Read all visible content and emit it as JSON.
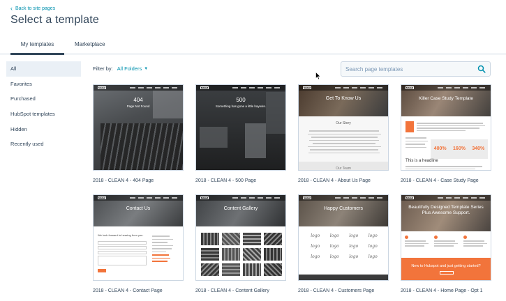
{
  "header": {
    "back_label": "Back to site pages",
    "title": "Select a template"
  },
  "tabs": [
    {
      "label": "My templates",
      "active": true
    },
    {
      "label": "Marketplace",
      "active": false
    }
  ],
  "sidebar": {
    "items": [
      {
        "label": "All",
        "active": true
      },
      {
        "label": "Favorites"
      },
      {
        "label": "Purchased"
      },
      {
        "label": "HubSpot templates"
      },
      {
        "label": "Hidden"
      },
      {
        "label": "Recently used"
      }
    ]
  },
  "filter": {
    "label": "Filter by:",
    "value": "All Folders"
  },
  "search": {
    "placeholder": "Search page templates"
  },
  "templates": [
    {
      "label": "2018 - CLEAN 4 - 404 Page",
      "hero_title": "404",
      "hero_sub": "Page Not Found"
    },
    {
      "label": "2018 - CLEAN 4 - 500 Page",
      "hero_title": "500",
      "hero_sub": "Something has gone a little haywire."
    },
    {
      "label": "2018 - CLEAN 4 - About Us Page",
      "hero_title": "Get To Know Us",
      "section": "Our Story",
      "footer": "Our Team"
    },
    {
      "label": "2018 - CLEAN 4 - Case Study Page",
      "hero_title": "Killer Case Study Template",
      "stats": [
        "400%",
        "160%",
        "340%"
      ],
      "headline": "This is a headline"
    },
    {
      "label": "2018 - CLEAN 4 - Contact Page",
      "hero_title": "Contact Us",
      "body": "We look forward to hearing from you."
    },
    {
      "label": "2018 - CLEAN 4 - Content Gallery",
      "hero_title": "Content Gallery"
    },
    {
      "label": "2018 - CLEAN 4 - Customers Page",
      "hero_title": "Happy Customers",
      "logo_text": "logo"
    },
    {
      "label": "2018 - CLEAN 4 - Home Page - Opt 1",
      "hero_title": "Beautifully Designed Template Series Plus Awesome Support.",
      "banner": "New to Hubspot and just getting started?"
    }
  ],
  "logo_text": "CLEAN",
  "colors": {
    "accent": "#0091ae",
    "text": "#33475b",
    "orange": "#f2743b",
    "sidebar_active": "#eaf0f6",
    "border": "#cbd6e2"
  }
}
